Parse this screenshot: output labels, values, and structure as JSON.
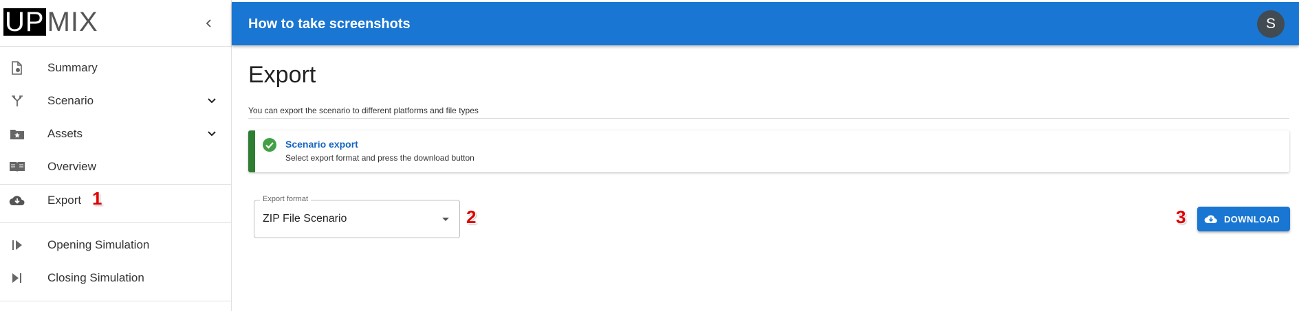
{
  "logo": {
    "part1": "UP",
    "part2": "MIX"
  },
  "topbar": {
    "title": "How to take screenshots",
    "avatar_letter": "S"
  },
  "sidebar": {
    "items": [
      {
        "label": "Summary",
        "icon": "document-gear-icon"
      },
      {
        "label": "Scenario",
        "icon": "fork-icon",
        "expandable": true
      },
      {
        "label": "Assets",
        "icon": "folder-star-icon",
        "expandable": true
      },
      {
        "label": "Overview",
        "icon": "book-icon"
      },
      {
        "label": "Export",
        "icon": "cloud-download-icon",
        "selected": true
      },
      {
        "label": "Opening Simulation",
        "icon": "play-start-icon"
      },
      {
        "label": "Closing Simulation",
        "icon": "skip-end-icon"
      }
    ]
  },
  "main": {
    "title": "Export",
    "description": "You can export the scenario to different platforms and file types",
    "alert": {
      "title": "Scenario export",
      "text": "Select export format and press the download button",
      "icon": "check-circle-icon",
      "accent": "#2e7d32"
    },
    "export_format": {
      "label": "Export format",
      "value": "ZIP File Scenario"
    },
    "download_button": {
      "label": "DOWNLOAD",
      "icon": "cloud-download-icon"
    }
  },
  "annotations": [
    "1",
    "2",
    "3"
  ],
  "colors": {
    "primary": "#1976d2",
    "success": "#2e7d32",
    "annotation": "#e00000",
    "avatar": "#424a52"
  }
}
